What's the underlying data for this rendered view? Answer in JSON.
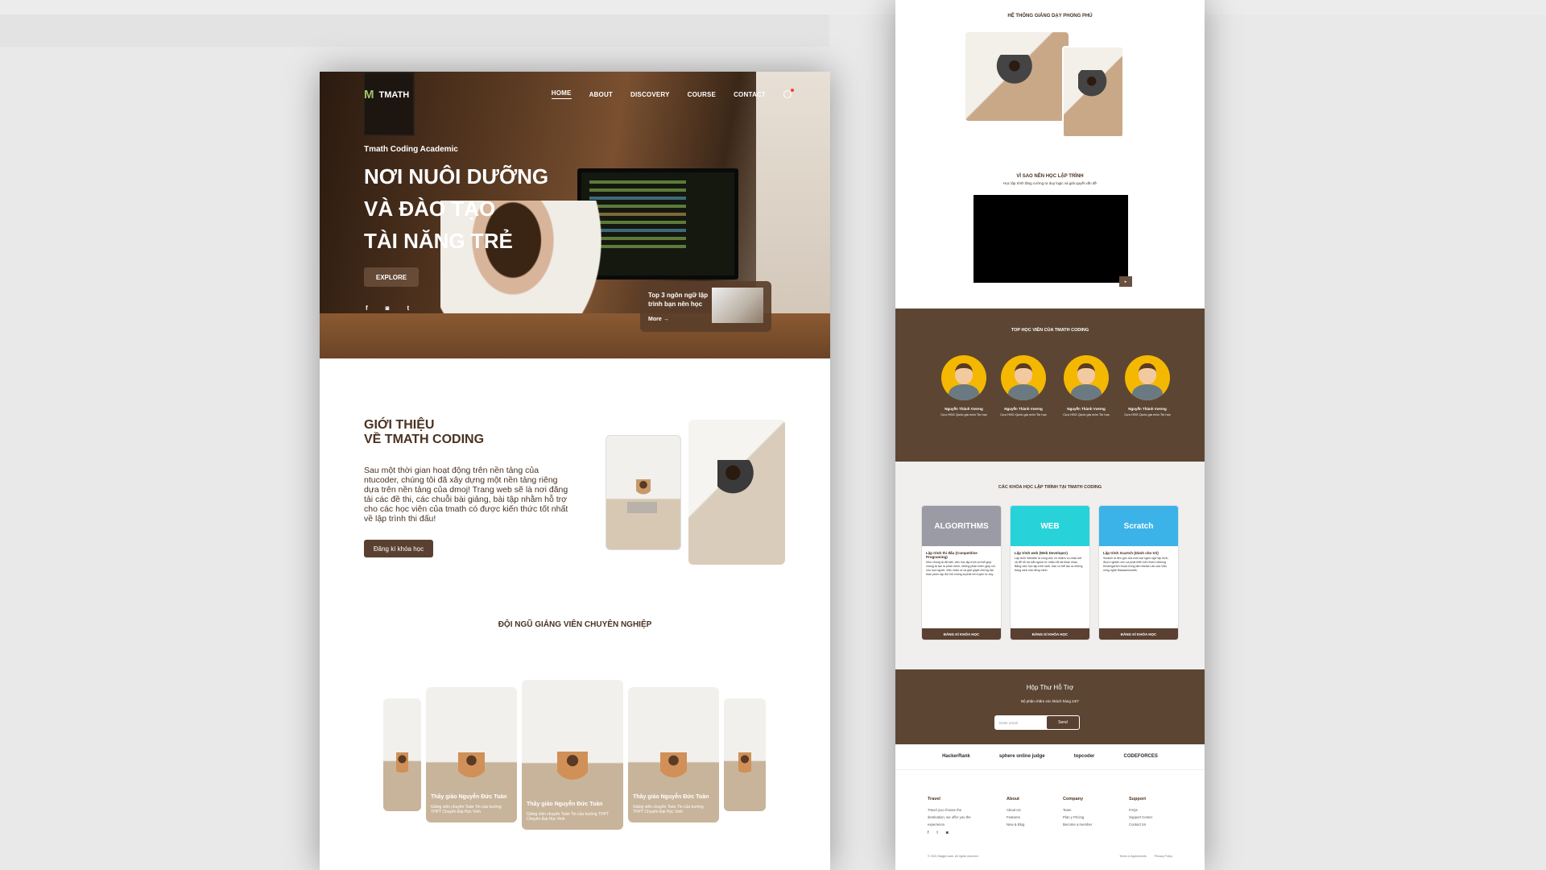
{
  "brand": {
    "logo_mark": "M",
    "name": "TMATH"
  },
  "nav": {
    "items": [
      "HOME",
      "ABOUT",
      "DISCOVERY",
      "COURSE",
      "CONTACT"
    ],
    "active": "HOME"
  },
  "hero": {
    "kicker": "Tmath Coding Academic",
    "headline_1": "NƠI NUÔI DƯỠNG",
    "headline_2": "VÀ ĐÀO TẠO",
    "headline_3": "TÀI NĂNG TRẺ",
    "explore": "EXPLORE",
    "card_text": "Top 3 ngôn ngữ lập trình bạn nên học",
    "card_more": "More →",
    "socials": [
      "f",
      "◙",
      "t"
    ]
  },
  "intro": {
    "title_1": "GIỚI THIỆU",
    "title_2": "VỀ TMATH CODING",
    "body": "Sau một thời gian hoạt động trên nền tảng của ntucoder, chúng tôi đã xây dựng một nền tảng riêng dựa trên nền tảng của dmoj! Trang web sẽ là nơi đăng tải các đề thi, các chuỗi bài giảng, bài tập nhằm hỗ trợ cho các học viên của tmath có được kiến thức tốt nhất về lập trình thi đấu!",
    "button": "Đăng kí khóa học"
  },
  "team": {
    "title": "ĐỘI NGŨ GIẢNG VIÊN CHUYÊN NGHIỆP",
    "teacher_name": "Thầy giáo Nguyễn Đức Toàn",
    "teacher_desc": "Giảng viên chuyên Toán Tin của trường THPT Chuyên Đại Học Vinh"
  },
  "right": {
    "title_system": "HỆ THỐNG GIẢNG DẠY PHONG PHÚ",
    "why_title": "VÌ SAO NÊN HỌC LẬP TRÌNH",
    "why_sub": "Học lập trình tăng cường tư duy logic và giải quyết vấn đề",
    "video_btn": "▸",
    "top_title": "TOP HỌC VIÊN CỦA TMATH CODING",
    "student_name": "Nguyễn Thành Vương",
    "student_desc": "Cựu HSG Quốc gia môn Tin học",
    "courses_title": "CÁC KHÓA HỌC LẬP TRÌNH TẠI TMATH CODING",
    "courses": [
      {
        "img_label": "ALGORITHMS",
        "color": "#9b9ba6",
        "title": "Lập trình thi đấu (Competitive Programing)",
        "desc": "Như chúng ta đã biết, việc học lập trình có thể giúp chúng ta tạo ra phần mềm, những phần mềm giúp ích cho mọi người. Việc nhận ra và giải quyết những bài toán phức tạp đòi hỏi chúng ta phải rèn luyện tư duy.",
        "button": "ĐĂNG KÍ KHÓA HỌC"
      },
      {
        "img_label": "WEB",
        "color": "#27d3d9",
        "title": "Lập trình web (Web Developer)",
        "desc": "Lập trình Website là công việc vô nhiệm vụ nhận kết cả để hỗ trợ bắt nguồn từ nhiều đề tài khác nhau. Bằng việc học lập trình web, bạn có thể tạo ra những trang web của riêng mình.",
        "button": "ĐĂNG KÍ KHÓA HỌC"
      },
      {
        "img_label": "Scratch",
        "color": "#3bb3e8",
        "title": "Lập trình Scartch (Dành cho trẻ)",
        "desc": "Scratch là tiện gốc của một loại ngôn ngữ lập trình, được nghiên cứu và phát triển bởi nhóm Lifelong Kindergarten thuộc trung tâm Media Lab của Viện công nghệ Massachusetts.",
        "button": "ĐĂNG KÍ KHÓA HỌC"
      }
    ],
    "support_title": "Hộp Thư Hỗ Trợ",
    "support_sub": "Bộ phận chăm sóc khách hàng 24/7",
    "email_placeholder": "Enter email",
    "send": "Send",
    "partners": [
      "HackerRank",
      "sphere online judge",
      "topcoder",
      "CODEFORCES"
    ],
    "footer": {
      "col1_h": "Travel",
      "col1_l": "Travel you choose the destination, we offer you the experience.",
      "col2_h": "About",
      "col2_items": [
        "About Us",
        "Features",
        "New & Blog"
      ],
      "col3_h": "Company",
      "col3_items": [
        "Team",
        "Plan y Pricing",
        "Become a member"
      ],
      "col4_h": "Support",
      "col4_items": [
        "FAQs",
        "Support Center",
        "Contact Us"
      ],
      "copyright": "© 2021 MagipCoder. All rights reserved",
      "terms": "Terms & Agreements",
      "privacy": "Privacy Policy"
    }
  }
}
